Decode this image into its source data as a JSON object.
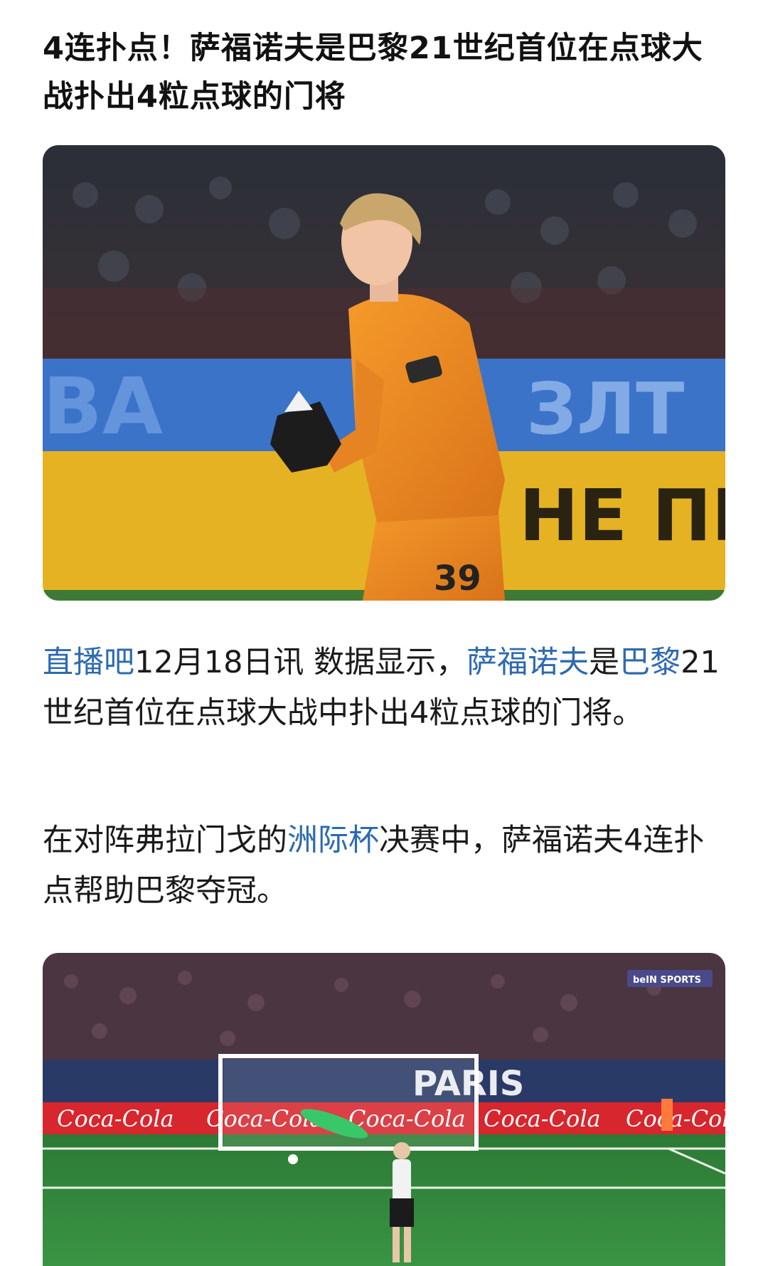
{
  "article": {
    "title": "4连扑点！萨福诺夫是巴黎21世纪首位在点球大战扑出4粒点球的门将",
    "paragraph1": {
      "source_link": "直播吧",
      "date_text": "12月18日讯 数据显示，",
      "player_link": "萨福诺夫",
      "mid_text": "是",
      "club_link": "巴黎",
      "rest_text": "21世纪首位在点球大战中扑出4粒点球的门将。"
    },
    "paragraph2": {
      "lead_text": "在对阵弗拉门戈的",
      "cup_link": "洲际杯",
      "rest_text": "决赛中，萨福诺夫4连扑点帮助巴黎夺冠。"
    }
  },
  "images": {
    "photo1": {
      "description": "orange-kit-goalkeeper-photo",
      "board_text_top": "ЗЛТ",
      "board_text_left": "BA",
      "board_text_bottom": "НЕ ПР",
      "shirt_number": "39"
    },
    "photo2": {
      "description": "penalty-shootout-broadcast",
      "ad_text": "Coca-Cola",
      "stadium_text": "PARIS",
      "broadcaster": "beIN SPORTS"
    }
  },
  "colors": {
    "link": "#2d6ab0",
    "text": "#1a1a1a",
    "goalkeeper_kit": "#f08a1c",
    "ad_board_blue": "#3b73c9",
    "ad_board_yellow": "#e5b224",
    "coca_cola_red": "#d7262d",
    "pitch_green": "#2f8a3c"
  }
}
